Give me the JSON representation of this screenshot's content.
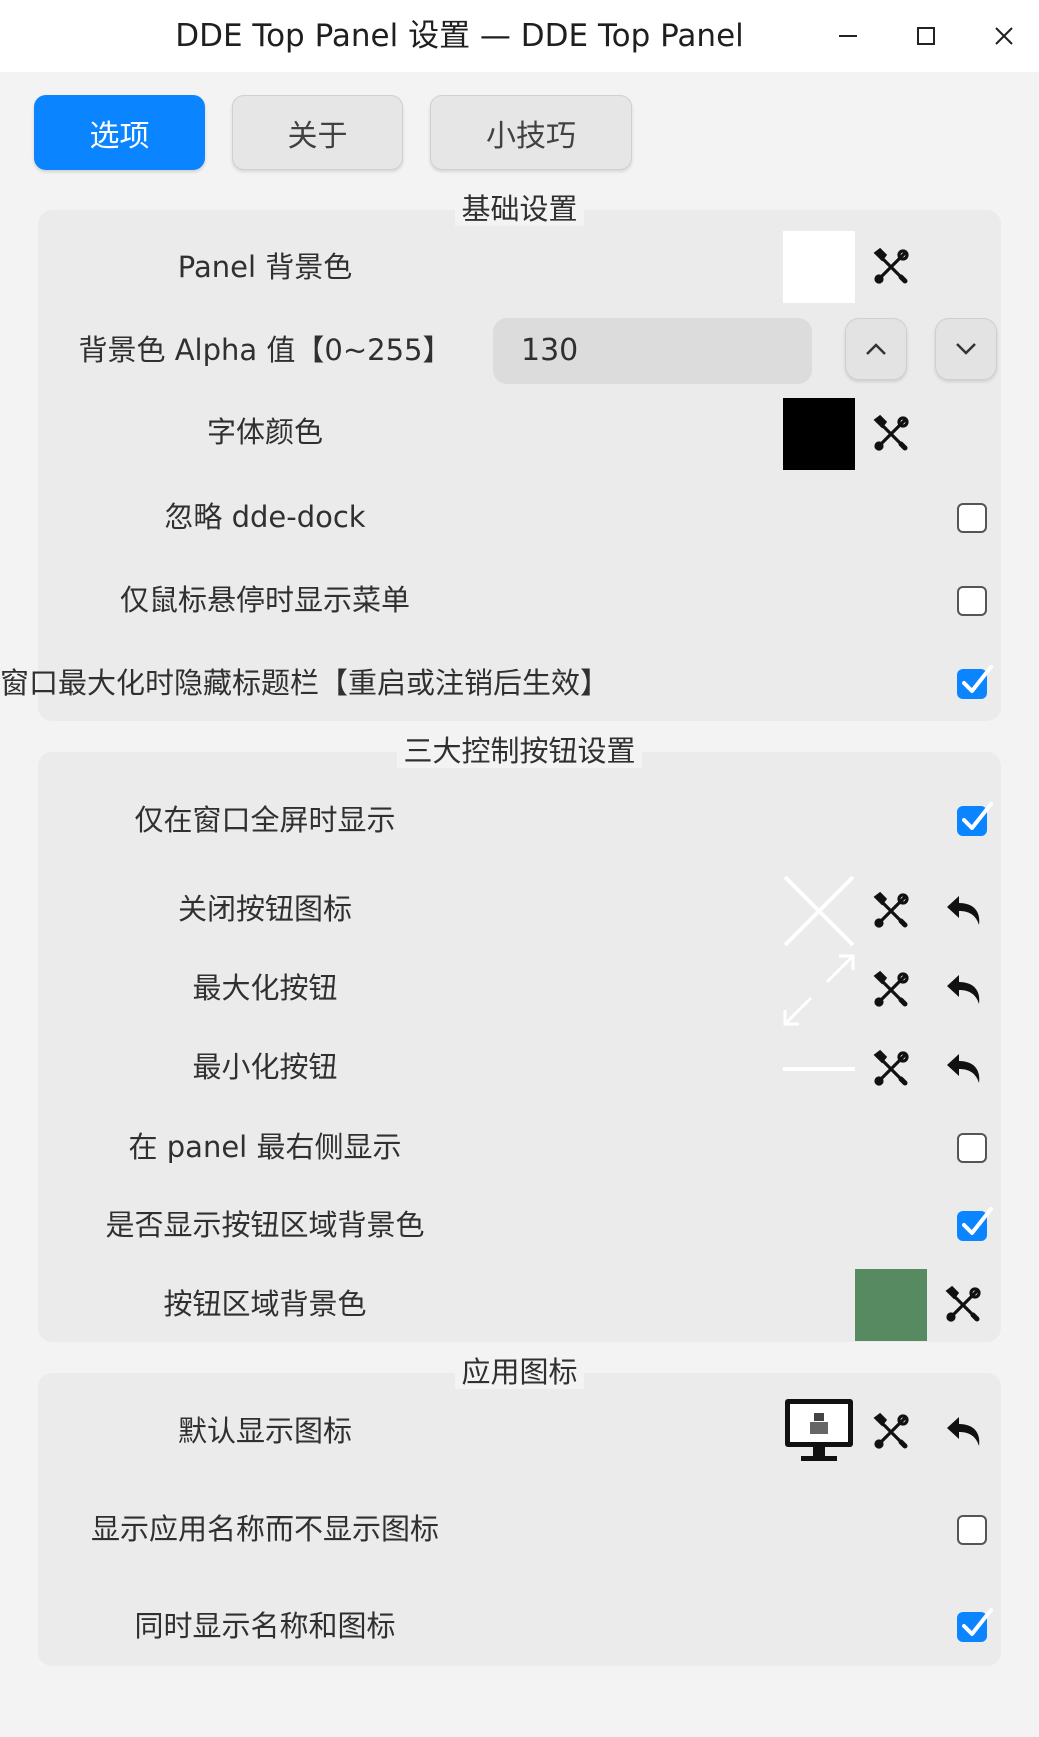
{
  "window": {
    "title": "DDE Top Panel 设置 — DDE Top Panel",
    "minimize_icon": "minimize-icon",
    "maximize_icon": "maximize-icon",
    "close_icon": "close-icon"
  },
  "tabs": [
    {
      "label": "选项",
      "active": true
    },
    {
      "label": "关于",
      "active": false
    },
    {
      "label": "小技巧",
      "active": false
    }
  ],
  "basic": {
    "title": "基础设置",
    "panel_bg_label": "Panel 背景色",
    "panel_bg_color": "#ffffff",
    "alpha_label": "背景色 Alpha 值【0~255】",
    "alpha_value": "130",
    "font_color_label": "字体颜色",
    "font_color": "#000000",
    "ignore_dock_label": "忽略 dde-dock",
    "ignore_dock_checked": false,
    "hover_menu_label": "仅鼠标悬停时显示菜单",
    "hover_menu_checked": false,
    "hide_titlebar_label": "窗口最大化时隐藏标题栏【重启或注销后生效】",
    "hide_titlebar_checked": true
  },
  "controls": {
    "title": "三大控制按钮设置",
    "fullscreen_only_label": "仅在窗口全屏时显示",
    "fullscreen_only_checked": true,
    "close_icon_label": "关闭按钮图标",
    "maximize_label": "最大化按钮",
    "minimize_label": "最小化按钮",
    "rightmost_label": "在 panel 最右侧显示",
    "rightmost_checked": false,
    "show_bg_label": "是否显示按钮区域背景色",
    "show_bg_checked": true,
    "bg_color_label": "按钮区域背景色",
    "bg_color": "#578a60"
  },
  "app_icon": {
    "title": "应用图标",
    "default_icon_label": "默认显示图标",
    "name_only_label": "显示应用名称而不显示图标",
    "name_only_checked": false,
    "both_label": "同时显示名称和图标",
    "both_checked": true
  },
  "icons": {
    "tools": "tools-icon",
    "reset": "undo-icon",
    "checkmark": "checkmark-icon",
    "spin_up": "chevron-up-icon",
    "spin_down": "chevron-down-icon",
    "computer": "computer-icon"
  }
}
